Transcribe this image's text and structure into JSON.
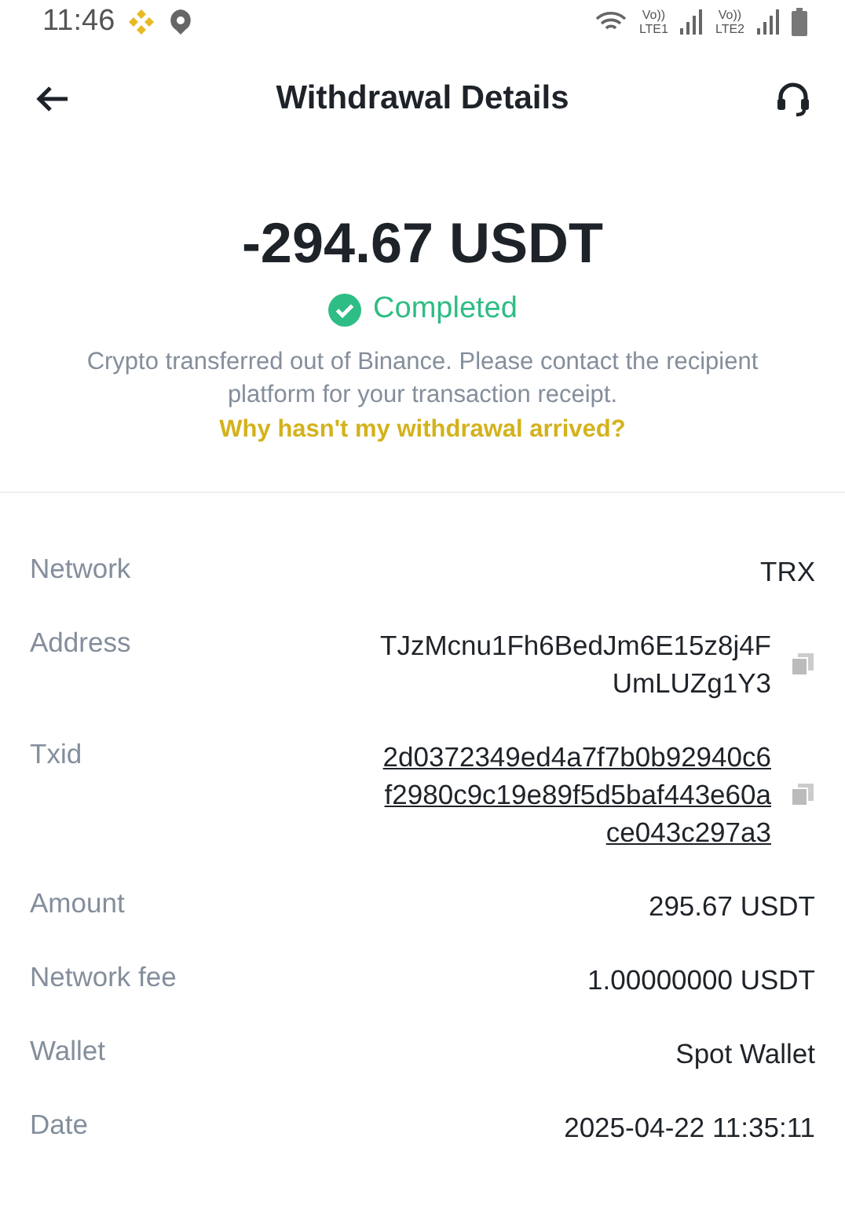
{
  "status_bar": {
    "time": "11:46",
    "sims": [
      {
        "volte": "Vo))",
        "label": "LTE1"
      },
      {
        "volte": "Vo))",
        "label": "LTE2"
      }
    ]
  },
  "header": {
    "title": "Withdrawal Details"
  },
  "summary": {
    "amount": "-294.67 USDT",
    "status": "Completed",
    "note": "Crypto transferred out of Binance. Please contact the recipient platform for your transaction receipt.",
    "help_link": "Why hasn't my withdrawal arrived?"
  },
  "details": [
    {
      "label": "Network",
      "kind": "text",
      "lines": [
        "TRX"
      ]
    },
    {
      "label": "Address",
      "kind": "copy",
      "lines": [
        "TJzMcnu1Fh6BedJm6E15z8j4F",
        "UmLUZg1Y3"
      ]
    },
    {
      "label": "Txid",
      "kind": "link",
      "lines": [
        "2d0372349ed4a7f7b0b92940c6",
        "f2980c9c19e89f5d5baf443e60a",
        "ce043c297a3"
      ]
    },
    {
      "label": "Amount",
      "kind": "text",
      "lines": [
        "295.67 USDT"
      ]
    },
    {
      "label": "Network fee",
      "kind": "text",
      "lines": [
        "1.00000000 USDT"
      ]
    },
    {
      "label": "Wallet",
      "kind": "text",
      "lines": [
        "Spot Wallet"
      ]
    },
    {
      "label": "Date",
      "kind": "text",
      "lines": [
        "2025-04-22 11:35:11"
      ]
    }
  ]
}
